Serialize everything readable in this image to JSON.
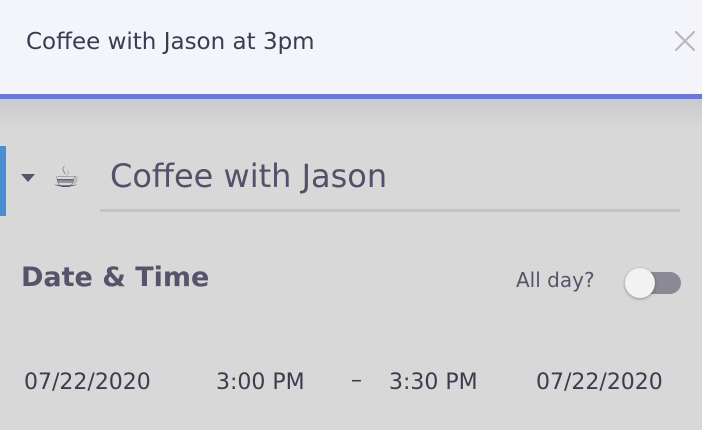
{
  "quick_entry": {
    "value": "Coffee with Jason at 3pm",
    "close_icon": "close-icon"
  },
  "event": {
    "emoji": "☕",
    "title": "Coffee with Jason",
    "marker_color": "#4a8fcf"
  },
  "date_time": {
    "heading": "Date & Time",
    "all_day_label": "All day?",
    "all_day": false,
    "start_date": "07/22/2020",
    "start_time": "3:00 PM",
    "separator": "–",
    "end_time": "3:30 PM",
    "end_date": "07/22/2020"
  },
  "colors": {
    "accent": "#6a79d6",
    "background": "#d8d8d8",
    "text": "#55546a"
  }
}
